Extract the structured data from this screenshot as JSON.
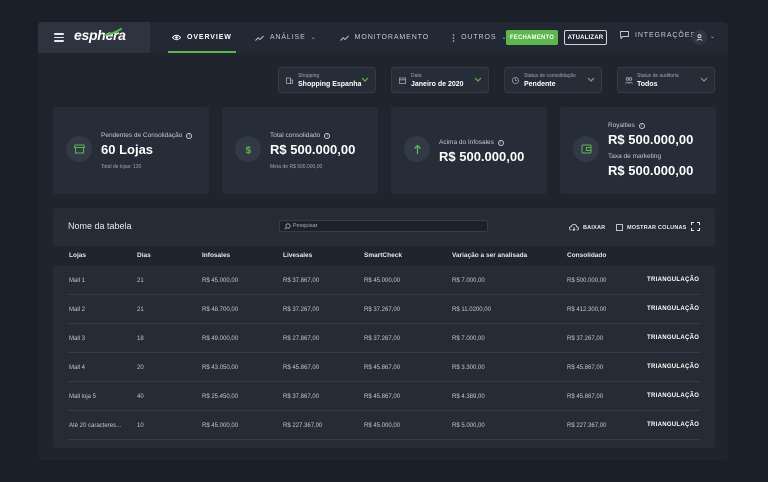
{
  "brand": {
    "logo_text": "esphera"
  },
  "nav": {
    "items": [
      {
        "label": "OVERVIEW",
        "icon": "eye-icon",
        "active": true
      },
      {
        "label": "ANÁLISE",
        "icon": "trend-icon",
        "caret": "⌄"
      },
      {
        "label": "MONITORAMENTO",
        "icon": "trend-icon"
      },
      {
        "label": "OUTROS",
        "icon": "dots-vertical-icon",
        "caret": "⌄"
      }
    ]
  },
  "actions": {
    "fechamento_label": "FECHAMENTO",
    "atualizar_label": "ATUALIZAR",
    "integracoes_label": "INTEGRAÇÕES",
    "user_caret": "⌄"
  },
  "filters": [
    {
      "label": "Shopping",
      "value": "Shopping Espanha",
      "icon": "building-icon"
    },
    {
      "label": "Data",
      "value": "Janeiro de 2020",
      "icon": "calendar-icon"
    },
    {
      "label": "Status de consolidação",
      "value": "Pendente",
      "icon": "clock-icon"
    },
    {
      "label": "Status de auditoria",
      "value": "Todos",
      "icon": "users-icon"
    }
  ],
  "cards": [
    {
      "label": "Pendentes de Consolidação",
      "value": "60 Lojas",
      "sub": "Total de lojas: 120",
      "icon": "store-icon"
    },
    {
      "label": "Total consolidado",
      "value": "R$ 500.000,00",
      "sub": "Meta de R$ 500.000,00",
      "icon": "dollar-icon"
    },
    {
      "label": "Acima do Infosales",
      "value": "R$ 500.000,00",
      "icon": "arrow-up-icon"
    },
    {
      "label": "Royalties",
      "value": "R$ 500.000,00",
      "label2": "Taxa de marketing",
      "value2": "R$ 500.000,00",
      "icon": "wallet-icon"
    }
  ],
  "table": {
    "title": "Nome da tabela",
    "search_placeholder": "Pesquisar",
    "download_label": "BAIXAR",
    "columns_label": "MOSTRAR COLUNAS",
    "headers": [
      "Lojas",
      "Dias",
      "Infosales",
      "Livesales",
      "SmartCheck",
      "Variação a ser analisada",
      "Consolidado"
    ],
    "rows": [
      [
        "Mall 1",
        "21",
        "R$ 45.000,00",
        "R$ 37.867,00",
        "R$ 45.000,00",
        "R$ 7.000,00",
        "R$ 500.000,00",
        "TRIANGULAÇÃO"
      ],
      [
        "Mall 2",
        "21",
        "R$ 48.700,00",
        "R$ 37.267,00",
        "R$ 37.267,00",
        "R$ 11.0200,00",
        "R$ 412.300,00",
        "TRIANGULAÇÃO"
      ],
      [
        "Mall 3",
        "18",
        "R$ 49.000,00",
        "R$ 27.867,00",
        "R$ 37.267,00",
        "R$ 7.000,00",
        "R$ 37.267,00",
        "TRIANGULAÇÃO"
      ],
      [
        "Mall 4",
        "20",
        "R$ 43.050,00",
        "R$ 45.867,00",
        "R$ 45.867,00",
        "R$ 3.300,00",
        "R$ 45.867,00",
        "TRIANGULAÇÃO"
      ],
      [
        "Mall loja 5",
        "40",
        "R$ 25.450,00",
        "R$ 37.867,00",
        "R$ 45.867,00",
        "R$ 4.389,00",
        "R$ 45.867,00",
        "TRIANGULAÇÃO"
      ],
      [
        "Até 20 caracteres...",
        "10",
        "R$ 45.000,00",
        "R$ 227.367,00",
        "R$ 45.000,00",
        "R$ 5.000,00",
        "R$ 227.367,00",
        "TRIANGULAÇÃO"
      ]
    ]
  },
  "colors": {
    "accent": "#5cb84a",
    "background": "#1b1f27",
    "panel": "#272d38"
  }
}
